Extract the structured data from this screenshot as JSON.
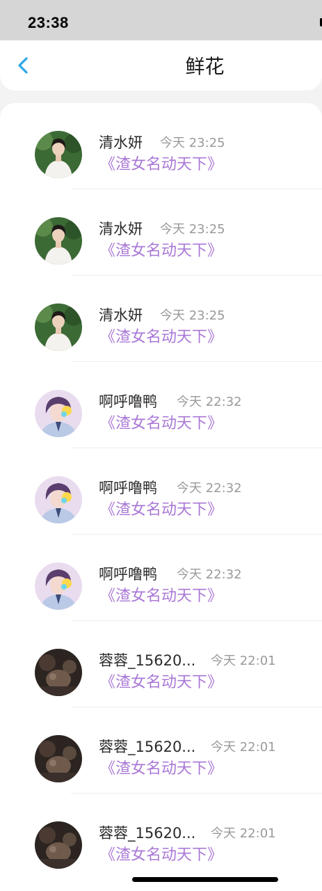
{
  "status_bar": {
    "time": "23:38"
  },
  "nav": {
    "title": "鲜花",
    "back_icon": "chevron-left-icon",
    "accent": "#2ea6e6"
  },
  "colors": {
    "book_link": "#a978d6",
    "muted": "#9a9a9a",
    "name": "#2b2b2b"
  },
  "list": [
    {
      "name": "清水妍",
      "time": "今天 23:25",
      "book": "《渣女名动天下》",
      "avatar": "avatar-photo-man-white-shirt"
    },
    {
      "name": "清水妍",
      "time": "今天 23:25",
      "book": "《渣女名动天下》",
      "avatar": "avatar-photo-man-white-shirt"
    },
    {
      "name": "清水妍",
      "time": "今天 23:25",
      "book": "《渣女名动天下》",
      "avatar": "avatar-photo-man-white-shirt"
    },
    {
      "name": "啊呼噜鸭",
      "time": "今天 22:32",
      "book": "《渣女名动天下》",
      "avatar": "avatar-anime-boy"
    },
    {
      "name": "啊呼噜鸭",
      "time": "今天 22:32",
      "book": "《渣女名动天下》",
      "avatar": "avatar-anime-boy"
    },
    {
      "name": "啊呼噜鸭",
      "time": "今天 22:32",
      "book": "《渣女名动天下》",
      "avatar": "avatar-anime-boy"
    },
    {
      "name": "蓉蓉_15620...",
      "time": "今天 22:01",
      "book": "《渣女名动天下》",
      "avatar": "avatar-dark-photo"
    },
    {
      "name": "蓉蓉_15620...",
      "time": "今天 22:01",
      "book": "《渣女名动天下》",
      "avatar": "avatar-dark-photo"
    },
    {
      "name": "蓉蓉_15620...",
      "time": "今天 22:01",
      "book": "《渣女名动天下》",
      "avatar": "avatar-dark-photo"
    }
  ]
}
